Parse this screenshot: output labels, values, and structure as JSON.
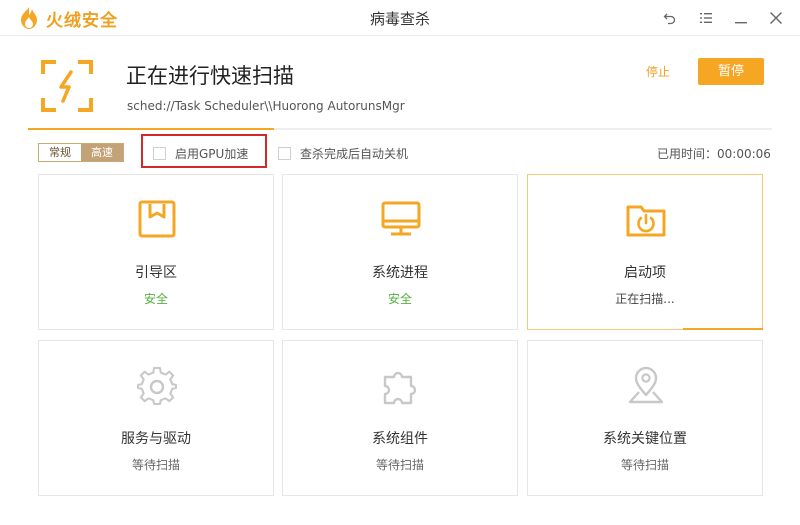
{
  "app": {
    "brand_name": "火绒安全",
    "window_title": "病毒查杀",
    "accent_color": "#f5a623"
  },
  "header": {
    "title": "正在进行快速扫描",
    "current_path": "sched://Task Scheduler\\\\Huorong AutorunsMgr",
    "stop_label": "停止",
    "pause_label": "暂停",
    "progress": 0.33
  },
  "options": {
    "mode_normal": "常规",
    "mode_fast": "高速",
    "gpu_label": "启用GPU加速",
    "gpu_checked": false,
    "shutdown_label": "查杀完成后自动关机",
    "shutdown_checked": false,
    "elapsed_label": "已用时间：",
    "elapsed_value": "00:00:06"
  },
  "cards": [
    {
      "name": "引导区",
      "status": "安全",
      "icon": "boot-sector-icon"
    },
    {
      "name": "系统进程",
      "status": "安全",
      "icon": "monitor-icon"
    },
    {
      "name": "启动项",
      "status": "正在扫描...",
      "icon": "startup-folder-icon"
    },
    {
      "name": "服务与驱动",
      "status": "等待扫描",
      "icon": "gear-icon"
    },
    {
      "name": "系统组件",
      "status": "等待扫描",
      "icon": "puzzle-icon"
    },
    {
      "name": "系统关键位置",
      "status": "等待扫描",
      "icon": "location-pin-icon"
    }
  ],
  "window_controls": [
    "back-icon",
    "menu-icon",
    "minimize-icon",
    "close-icon"
  ]
}
